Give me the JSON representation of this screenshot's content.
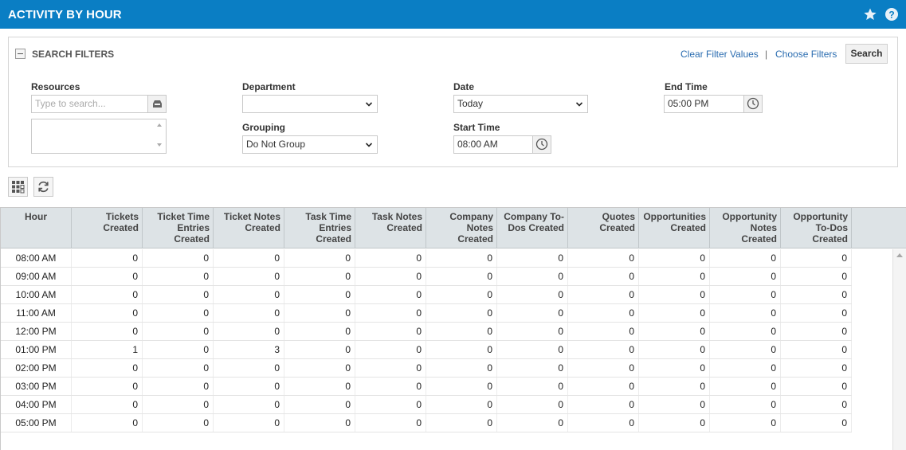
{
  "header": {
    "title": "ACTIVITY BY HOUR",
    "accent": "#0a7ec4",
    "icons": [
      "star-icon",
      "help-icon"
    ]
  },
  "filters": {
    "title": "SEARCH FILTERS",
    "clear_label": "Clear Filter Values",
    "separator": "|",
    "choose_label": "Choose Filters",
    "search_label": "Search",
    "resources": {
      "label": "Resources",
      "placeholder": "Type to search..."
    },
    "department": {
      "label": "Department",
      "value": ""
    },
    "grouping": {
      "label": "Grouping",
      "value": "Do Not Group"
    },
    "date": {
      "label": "Date",
      "value": "Today"
    },
    "start_time": {
      "label": "Start Time",
      "value": "08:00 AM"
    },
    "end_time": {
      "label": "End Time",
      "value": "05:00 PM"
    }
  },
  "table": {
    "columns": [
      "Hour",
      "Tickets Created",
      "Ticket Time Entries Created",
      "Ticket Notes Created",
      "Task Time Entries Created",
      "Task Notes Created",
      "Company Notes Created",
      "Company To-Dos Created",
      "Quotes Created",
      "Opportunities Created",
      "Opportunity Notes Created",
      "Opportunity To-Dos Created"
    ],
    "rows": [
      [
        "08:00 AM",
        "0",
        "0",
        "0",
        "0",
        "0",
        "0",
        "0",
        "0",
        "0",
        "0",
        "0"
      ],
      [
        "09:00 AM",
        "0",
        "0",
        "0",
        "0",
        "0",
        "0",
        "0",
        "0",
        "0",
        "0",
        "0"
      ],
      [
        "10:00 AM",
        "0",
        "0",
        "0",
        "0",
        "0",
        "0",
        "0",
        "0",
        "0",
        "0",
        "0"
      ],
      [
        "11:00 AM",
        "0",
        "0",
        "0",
        "0",
        "0",
        "0",
        "0",
        "0",
        "0",
        "0",
        "0"
      ],
      [
        "12:00 PM",
        "0",
        "0",
        "0",
        "0",
        "0",
        "0",
        "0",
        "0",
        "0",
        "0",
        "0"
      ],
      [
        "01:00 PM",
        "1",
        "0",
        "3",
        "0",
        "0",
        "0",
        "0",
        "0",
        "0",
        "0",
        "0"
      ],
      [
        "02:00 PM",
        "0",
        "0",
        "0",
        "0",
        "0",
        "0",
        "0",
        "0",
        "0",
        "0",
        "0"
      ],
      [
        "03:00 PM",
        "0",
        "0",
        "0",
        "0",
        "0",
        "0",
        "0",
        "0",
        "0",
        "0",
        "0"
      ],
      [
        "04:00 PM",
        "0",
        "0",
        "0",
        "0",
        "0",
        "0",
        "0",
        "0",
        "0",
        "0",
        "0"
      ],
      [
        "05:00 PM",
        "0",
        "0",
        "0",
        "0",
        "0",
        "0",
        "0",
        "0",
        "0",
        "0",
        "0"
      ]
    ]
  }
}
